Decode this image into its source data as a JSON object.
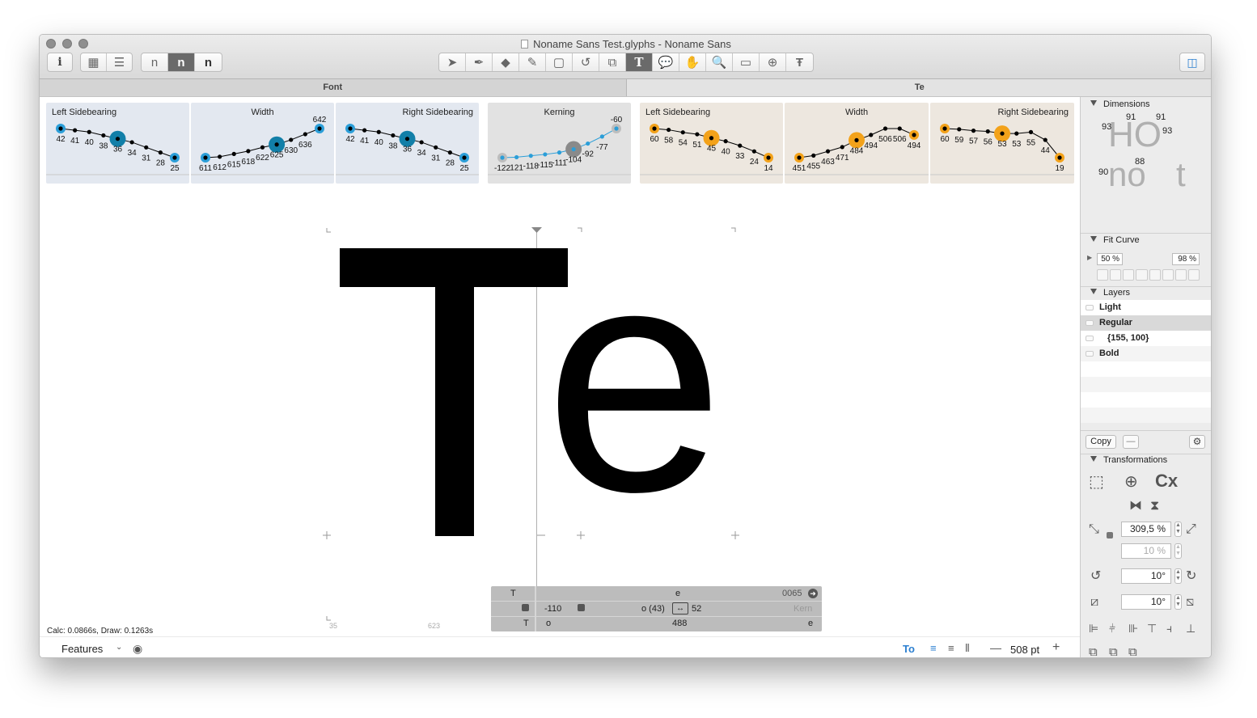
{
  "window": {
    "title": "Noname Sans Test.glyphs - Noname Sans"
  },
  "toolbar": {
    "info_label": "i",
    "preview_glyphs": [
      "n",
      "n",
      "n"
    ],
    "tools": [
      "select-tool",
      "draw-pen-tool",
      "eraser-tool",
      "pencil-tool",
      "rectangle-tool",
      "rotate-tool",
      "scale-tool",
      "text-tool",
      "annotation-tool",
      "hand-tool",
      "zoom-tool",
      "measurement-tool",
      "anchor-tool",
      "text-format-tool"
    ],
    "text_tool_label": "T"
  },
  "tabs": [
    {
      "label": "Font"
    },
    {
      "label": "Te"
    }
  ],
  "plots": [
    {
      "title": "Left Sidebearing",
      "values": [
        42,
        41,
        40,
        38,
        36,
        34,
        31,
        28,
        25
      ],
      "labels": [
        "42",
        "41",
        "40",
        "38",
        "36",
        "34",
        "31",
        "28",
        "25"
      ],
      "highlight": 4,
      "theme": "blue",
      "align": "left"
    },
    {
      "title": "Width",
      "values": [
        611,
        612,
        615,
        618,
        622,
        625,
        630,
        636,
        642
      ],
      "labels": [
        "611",
        "612",
        "615",
        "618",
        "622",
        "625",
        "630",
        "636",
        "642"
      ],
      "highlight": 5,
      "theme": "blue",
      "align": "center"
    },
    {
      "title": "Right Sidebearing",
      "values": [
        42,
        41,
        40,
        38,
        36,
        34,
        31,
        28,
        25
      ],
      "labels": [
        "42",
        "41",
        "40",
        "38",
        "36",
        "34",
        "31",
        "28",
        "25"
      ],
      "highlight": 4,
      "theme": "blue",
      "align": "right"
    },
    {
      "title": "Kerning",
      "values": [
        -122,
        -121,
        -118,
        -115,
        -111,
        -104,
        -92,
        -77,
        -60
      ],
      "labels": [
        "-122",
        "121",
        "-118",
        "-115",
        "-111",
        "-104",
        "-92",
        "-77",
        "-60"
      ],
      "highlight": 5,
      "theme": "gray",
      "align": "center"
    },
    {
      "title": "Left Sidebearing",
      "values": [
        60,
        58,
        54,
        51,
        45,
        40,
        33,
        24,
        14
      ],
      "labels": [
        "60",
        "58",
        "54",
        "51",
        "45",
        "40",
        "33",
        "24",
        "14"
      ],
      "highlight": 4,
      "theme": "orange",
      "align": "left"
    },
    {
      "title": "Width",
      "values": [
        451,
        455,
        463,
        471,
        484,
        494,
        506,
        506,
        494
      ],
      "labels": [
        "451",
        "455",
        "463",
        "471",
        "484",
        "494",
        "506",
        "506",
        "494"
      ],
      "highlight": 4,
      "theme": "orange",
      "align": "center"
    },
    {
      "title": "Right Sidebearing",
      "values": [
        60,
        59,
        57,
        56,
        53,
        53,
        55,
        44,
        19
      ],
      "labels": [
        "60",
        "59",
        "57",
        "56",
        "53",
        "53",
        "55",
        "44",
        "19"
      ],
      "highlight": 4,
      "theme": "orange",
      "align": "right"
    }
  ],
  "canvas": {
    "glyph_T": "T",
    "glyph_e": "e",
    "left_metric": "35",
    "mid_metric": "623"
  },
  "metrics_panel": {
    "glyph_left": "T",
    "glyph_right": "e",
    "unicode": "0065",
    "left_kern": "-110",
    "kern_pair": "o (43)",
    "kern_value": "52",
    "kern_label": "Kern",
    "group_left": "T",
    "group_o": "o",
    "width": "488",
    "group_e": "e"
  },
  "status": {
    "calc": "Calc: 0.0866s, Draw: 0.1263s"
  },
  "bottom": {
    "features": "Features",
    "zoom": "508 pt",
    "text_flag": "To"
  },
  "sidebar": {
    "dimensions": {
      "title": "Dimensions",
      "sample_upper": "HO",
      "sample_lower": "no",
      "sample_t": "t",
      "values": [
        "93",
        "91",
        "91",
        "93",
        "90",
        "88"
      ]
    },
    "fit_curve": {
      "title": "Fit Curve",
      "min": "50 %",
      "max": "98 %"
    },
    "layers": {
      "title": "Layers",
      "items": [
        {
          "name": "Light"
        },
        {
          "name": "Regular"
        },
        {
          "name": "{155, 100}"
        },
        {
          "name": "Bold"
        }
      ]
    },
    "copy_label": "Copy",
    "minus_label": "—",
    "transformations": {
      "title": "Transformations",
      "scale": "309,5 %",
      "scale_y": "10 %",
      "rotate": "10°",
      "slant": "10°",
      "cx_label": "Cx"
    }
  },
  "colors": {
    "accent_blue": "#2b9ed8",
    "orange": "#f3a21a",
    "plot_blue_bg": "#e3e8f0",
    "plot_orange_bg": "#ede7df",
    "plot_gray_bg": "#e2e2e2"
  }
}
